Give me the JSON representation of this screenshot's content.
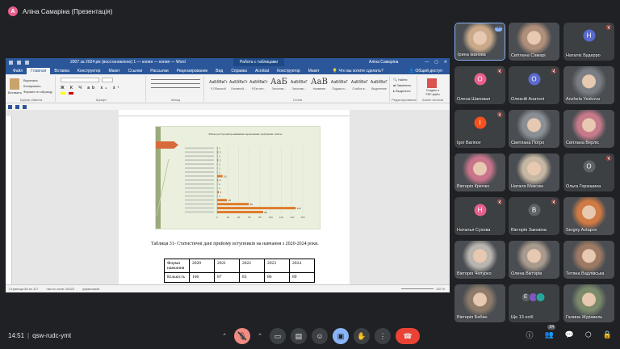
{
  "presenter": {
    "initial": "А",
    "label": "Аліна Самаріна (Презентація)"
  },
  "word": {
    "doc_title": "2007 за 2024 рік (восстановлено) 1 — копия — копия — Word",
    "context_tab": "Работа с таблицами",
    "user": "Аліна Самаріна",
    "tabs": [
      "Файл",
      "Главная",
      "Вставка",
      "Конструктор",
      "Макет",
      "Ссылки",
      "Рассылки",
      "Рецензирование",
      "Вид",
      "Справка",
      "Acrobat",
      "Конструктор",
      "Макет"
    ],
    "tell_me": "Что вы хотите сделать?",
    "share": "Общий доступ",
    "ribbon": {
      "paste": "Вставить",
      "cut": "Вырезать",
      "copy": "Копировать",
      "format_painter": "Формат по образцу",
      "clipboard": "Буфер обмена",
      "font": "Шрифт",
      "paragraph": "Абзац",
      "styles_label": "Стили",
      "styles": [
        {
          "sample": "АаБбВвГг",
          "name": "¶ Обычный"
        },
        {
          "sample": "АаБбВеГг",
          "name": "Основной..."
        },
        {
          "sample": "АаБбВвГг",
          "name": "¶ Без инт..."
        },
        {
          "sample": "АаБ",
          "name": "Заголово..."
        },
        {
          "sample": "АаБбВеГ",
          "name": "Заголово..."
        },
        {
          "sample": "АаВ",
          "name": "Название"
        },
        {
          "sample": "АаБбВеГ",
          "name": "Подзагол..."
        },
        {
          "sample": "АаБбВеГ",
          "name": "Слабое в..."
        },
        {
          "sample": "АаБбВеГ",
          "name": "Выделение"
        }
      ],
      "find": "Найти",
      "replace": "Заменить",
      "select": "Выделить",
      "editing": "Редактирование",
      "pdf_create": "Создать и",
      "pdf_share": "PDF-файл",
      "acrobat": "Adobe Acrobat"
    },
    "slide_title": "Місце реєстрації проживання зарахованих здобувачів освіти:",
    "caption": "Таблиця 31- Статистичні дані прийому вступників на навчання з 2020-2024 роки.",
    "table": [
      [
        "Форми навчання",
        "2020",
        "2021",
        "2022",
        "2023",
        "2024"
      ],
      [
        "Кількість",
        "106",
        "87",
        "83",
        "86",
        "89"
      ]
    ],
    "status": {
      "page": "Страница 86 из 117",
      "words": "Число слов: 20022",
      "lang": "украинский",
      "zoom": "110 %"
    }
  },
  "chart_data": {
    "type": "bar",
    "orientation": "horizontal",
    "title": "Місце реєстрації проживання зарахованих здобувачів освіти:",
    "categories": [
      "",
      "",
      "",
      "",
      "",
      "",
      "",
      "",
      "",
      "",
      "",
      "",
      "",
      "",
      "",
      "",
      ""
    ],
    "values": [
      1,
      2,
      1,
      2,
      1,
      1,
      1,
      10,
      2,
      1,
      1,
      3,
      1,
      18,
      59,
      147,
      86
    ],
    "data_labels": [
      "1",
      "2",
      "1",
      "2",
      "1",
      "1",
      "1",
      "10",
      "2",
      "1",
      "1",
      "3",
      "1",
      "18",
      "59",
      "147",
      "86"
    ],
    "xlim": [
      0,
      160
    ],
    "color": "#e07a2c"
  },
  "participants": [
    {
      "name": "Ірина Іванова",
      "kind": "video",
      "more": true,
      "bg": "#c9a98a"
    },
    {
      "name": "Світлана Самарі",
      "kind": "video",
      "bg": "#b08f7a"
    },
    {
      "name": "Наталіє Будерро",
      "kind": "avatar",
      "initial": "Н",
      "color": "#5b6ad0"
    },
    {
      "name": "Олена Шаповал",
      "kind": "avatar",
      "initial": "О",
      "color": "#e8608c"
    },
    {
      "name": "Олексій Анатолі",
      "kind": "avatar",
      "initial": "О",
      "color": "#5b6ad0"
    },
    {
      "name": "Anzhela Yeskova",
      "kind": "photo",
      "bg": "#7a7e84"
    },
    {
      "name": "Igor Barinov",
      "kind": "avatar",
      "initial": "I",
      "color": "#f4511e"
    },
    {
      "name": "Светлана Погро",
      "kind": "photo",
      "bg": "#8a8f95"
    },
    {
      "name": "Світлана Верліс",
      "kind": "photo",
      "bg": "#c77a8a"
    },
    {
      "name": "Вікторія Крючко",
      "kind": "photo",
      "bg": "#c9748b"
    },
    {
      "name": "Наталя Максим",
      "kind": "video",
      "bg": "#c6b7a3"
    },
    {
      "name": "Ольга Горюшина",
      "kind": "avatar",
      "initial": "О",
      "color": "#5f6368"
    },
    {
      "name": "Наталья Сухова",
      "kind": "avatar",
      "initial": "Н",
      "color": "#e8608c"
    },
    {
      "name": "Вікторія Заковіна",
      "kind": "avatar",
      "initial": "В",
      "color": "#5f6368"
    },
    {
      "name": "Sergey Astapov",
      "kind": "video",
      "bg": "#d17a44"
    },
    {
      "name": "Вікторія Чепурко",
      "kind": "video",
      "bg": "#b8b4ae"
    },
    {
      "name": "Олена Вікторів",
      "kind": "video",
      "bg": "#a89a8c"
    },
    {
      "name": "Тетяна Вадлівська",
      "kind": "video",
      "bg": "#9e7a64"
    },
    {
      "name": "Вікторія Бабин",
      "kind": "video",
      "bg": "#8e7b6a"
    },
    {
      "name": "Ще 13 осіб",
      "kind": "stack",
      "colors": [
        "#5f6368",
        "#7e57c2",
        "#26a69a"
      ],
      "initials": [
        "Е",
        "",
        ""
      ]
    },
    {
      "name": "Галина Журавель",
      "kind": "video",
      "bg": "#7a8a6a"
    }
  ],
  "bottom": {
    "time": "14:51",
    "separator": "|",
    "meeting_code": "qsw-rudc-ymt",
    "participant_count": "34"
  }
}
